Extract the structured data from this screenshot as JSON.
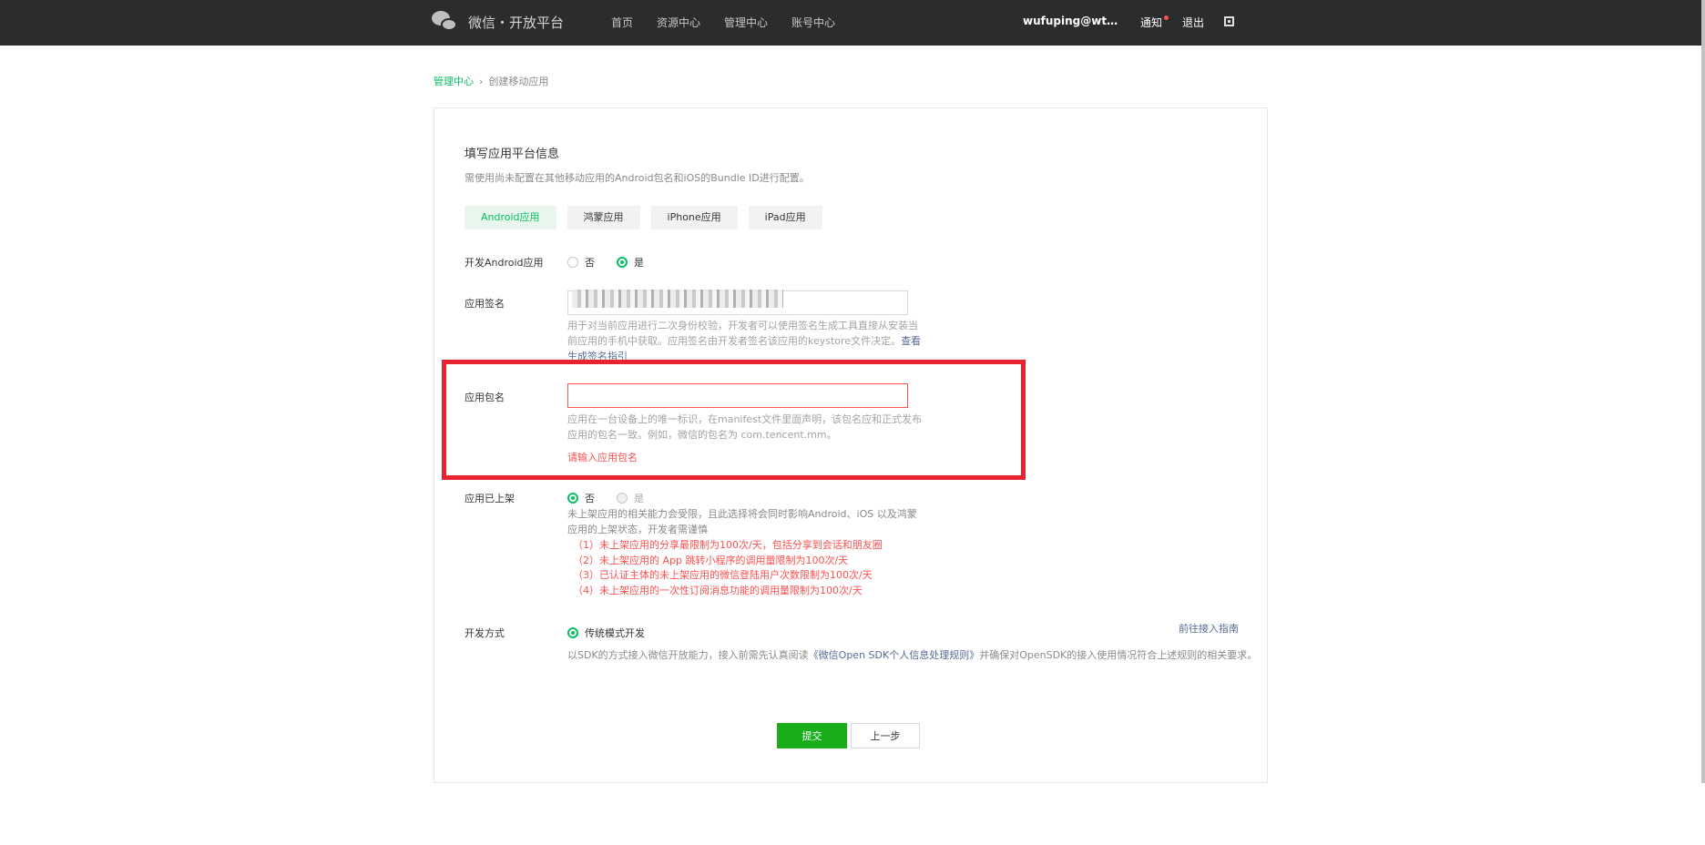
{
  "header": {
    "logo_text": "微信・开放平台",
    "nav": [
      "首页",
      "资源中心",
      "管理中心",
      "账号中心"
    ],
    "user": "wufuping@wtutec...",
    "notice": "通知",
    "logout": "退出"
  },
  "breadcrumb": {
    "parent": "管理中心",
    "current": "创建移动应用"
  },
  "form": {
    "title": "填写应用平台信息",
    "description": "需使用尚未配置在其他移动应用的Android包名和iOS的Bundle ID进行配置。",
    "tabs": [
      "Android应用",
      "鸿蒙应用",
      "iPhone应用",
      "iPad应用"
    ],
    "active_tab": "Android应用",
    "dev_android": {
      "label": "开发Android应用",
      "options": [
        "否",
        "是"
      ],
      "selected": "是"
    },
    "signature": {
      "label": "应用签名",
      "help_text": "用于对当前应用进行二次身份校验，开发者可以使用签名生成工具直接从安装当前应用的手机中获取。应用签名由开发者签名该应用的keystore文件决定。",
      "help_link": "查看生成签名指引"
    },
    "package": {
      "label": "应用包名",
      "value": "",
      "help_text": "应用在一台设备上的唯一标识，在manifest文件里面声明，该包名应和正式发布应用的包名一致。例如，微信的包名为 com.tencent.mm。",
      "error": "请输入应用包名"
    },
    "published": {
      "label": "应用已上架",
      "options": [
        "否",
        "是"
      ],
      "selected": "否",
      "help_text": "未上架应用的相关能力会受限，且此选择将会同时影响Android、iOS 以及鸿蒙应用的上架状态，开发者需谨慎",
      "rules": [
        "（1）未上架应用的分享最限制为100次/天，包括分享到会话和朋友圈",
        "（2）未上架应用的 App 跳转小程序的调用量限制为100次/天",
        "（3）已认证主体的未上架应用的微信登陆用户次数限制为100次/天",
        "（4）未上架应用的一次性订阅消息功能的调用量限制为100次/天"
      ]
    },
    "dev_mode": {
      "label": "开发方式",
      "option": "传统模式开发",
      "guide_link": "前往接入指南",
      "desc_prefix": "以SDK的方式接入微信开放能力，接入前需先认真阅读",
      "desc_link": "《微信Open SDK个人信息处理规则》",
      "desc_suffix": "并确保对OpenSDK的接入使用情况符合上述规则的相关要求。"
    },
    "submit": "提交",
    "back": "上一步"
  }
}
